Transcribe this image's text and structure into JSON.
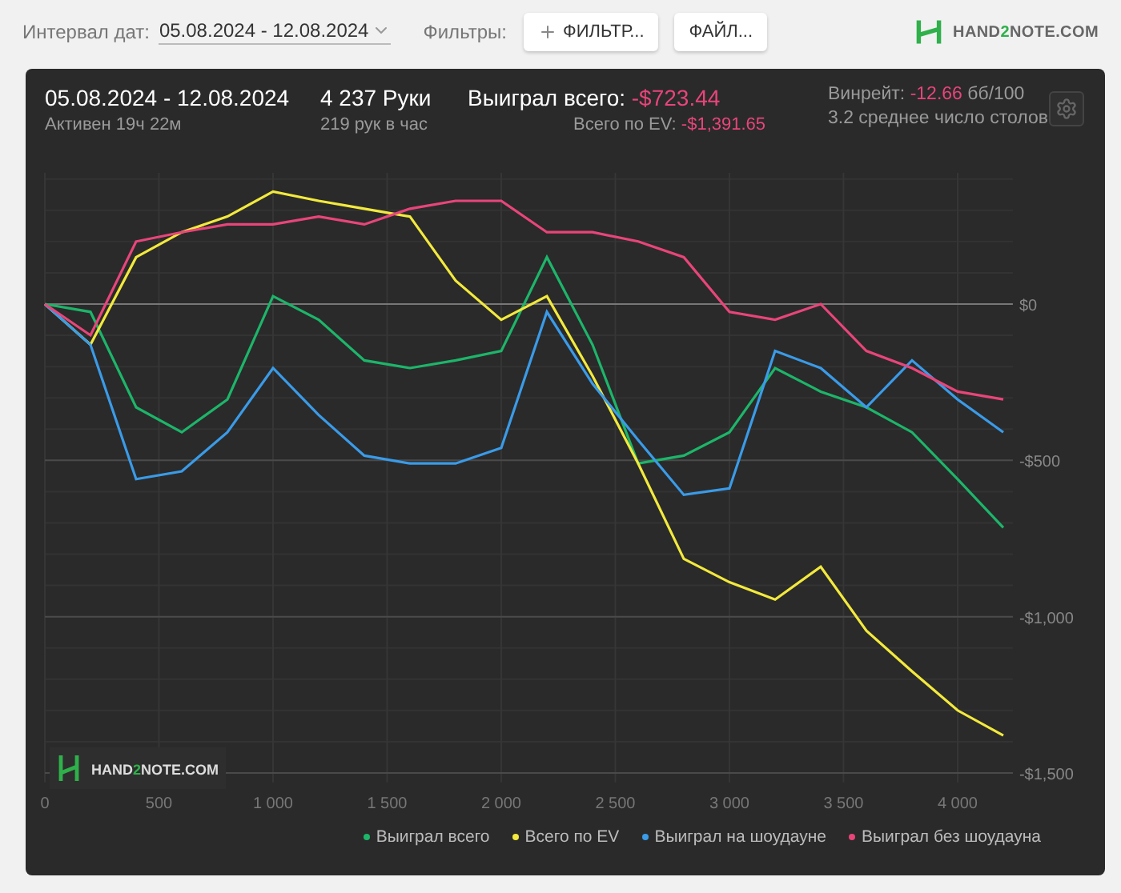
{
  "toolbar": {
    "date_label": "Интервал дат:",
    "date_value": "05.08.2024 - 12.08.2024",
    "filters_label": "Фильтры:",
    "buttons": [
      {
        "label": "ФИЛЬТР...",
        "kind": "add"
      },
      {
        "label": "ФАЙЛ...",
        "kind": "plain"
      }
    ],
    "logo": [
      "HAND",
      "2",
      "NOTE.COM"
    ]
  },
  "summary": {
    "period": "05.08.2024 - 12.08.2024",
    "active": "Активен 19ч 22м",
    "hands": "4 237 Руки",
    "rate": "219 рук в час",
    "won_label": "Выиграл всего:",
    "won_value": "-$723.44",
    "ev_label": "Всего по EV:",
    "ev_value": "-$1,391.65",
    "winrate_label": "Винрейт:",
    "winrate_value": "-12.66",
    "winrate_unit": "бб/100",
    "tables": "3.2 среднее число столов"
  },
  "chart": {
    "watermark": [
      "HAND",
      "2",
      "NOTE.COM"
    ],
    "chart_data": {
      "type": "line",
      "x": [
        0,
        200,
        400,
        600,
        800,
        1000,
        1200,
        1400,
        1600,
        1800,
        2000,
        2200,
        2400,
        2600,
        2800,
        3000,
        3200,
        3400,
        3600,
        3800,
        4000,
        4200
      ],
      "xlim": [
        0,
        4250
      ],
      "grid": true,
      "ylim": [
        -1530,
        420
      ],
      "xticks": [
        {
          "value": 0,
          "label": "0"
        },
        {
          "value": 500,
          "label": "500"
        },
        {
          "value": 1000,
          "label": "1 000"
        },
        {
          "value": 1500,
          "label": "1 500"
        },
        {
          "value": 2000,
          "label": "2 000"
        },
        {
          "value": 2500,
          "label": "2 500"
        },
        {
          "value": 3000,
          "label": "3 000"
        },
        {
          "value": 3500,
          "label": "3 500"
        },
        {
          "value": 4000,
          "label": "4 000"
        }
      ],
      "yticks": [
        {
          "value": 0,
          "label": "$0"
        },
        {
          "value": -500,
          "label": "-$500"
        },
        {
          "value": -1000,
          "label": "-$1,000"
        },
        {
          "value": -1500,
          "label": "-$1,500"
        }
      ],
      "series": [
        {
          "name": "Выиграл всего",
          "color": "#1db56a",
          "values": [
            0,
            -25,
            -330,
            -410,
            -305,
            25,
            -50,
            -180,
            -205,
            -180,
            -150,
            150,
            -130,
            -510,
            -485,
            -410,
            -205,
            -280,
            -330,
            -410,
            -560,
            -715
          ]
        },
        {
          "name": "Всего по EV",
          "color": "#f2e93d",
          "values": [
            0,
            -130,
            150,
            230,
            280,
            360,
            330,
            305,
            280,
            75,
            -50,
            25,
            -230,
            -510,
            -815,
            -890,
            -945,
            -840,
            -1045,
            -1175,
            -1300,
            -1380
          ]
        },
        {
          "name": "Выиграл на шоудауне",
          "color": "#3a9be8",
          "values": [
            0,
            -130,
            -560,
            -535,
            -410,
            -205,
            -355,
            -485,
            -510,
            -510,
            -460,
            -25,
            -255,
            -435,
            -610,
            -590,
            -150,
            -205,
            -330,
            -180,
            -305,
            -410
          ]
        },
        {
          "name": "Выиграл без шоудауна",
          "color": "#e8457a",
          "values": [
            0,
            -100,
            200,
            230,
            255,
            255,
            280,
            255,
            305,
            330,
            330,
            230,
            230,
            200,
            150,
            -25,
            -50,
            0,
            -150,
            -205,
            -280,
            -305
          ]
        }
      ]
    }
  }
}
